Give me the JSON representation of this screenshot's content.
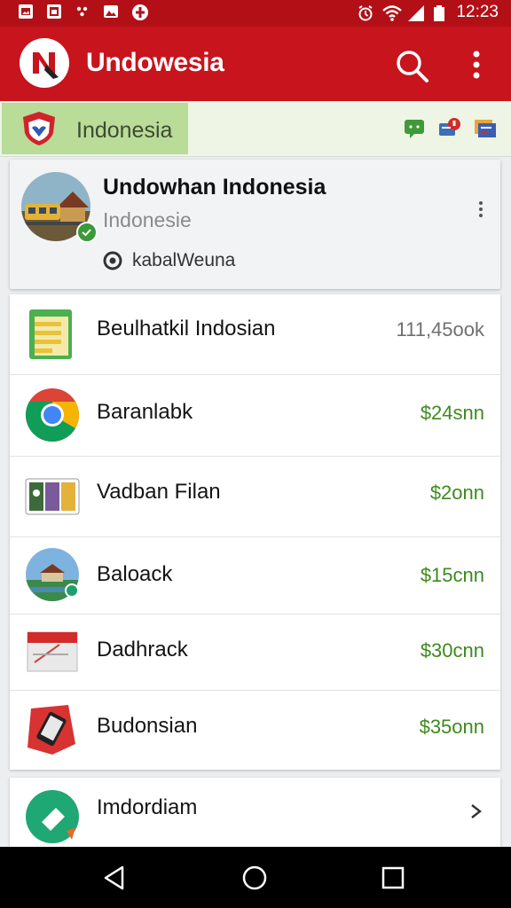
{
  "status_bar": {
    "time": "12:23",
    "left_icons": [
      "image-icon",
      "image-icon",
      "dots-icon",
      "photo-icon",
      "app-icon"
    ],
    "right_icons": [
      "alarm-icon",
      "wifi-icon",
      "signal-icon",
      "battery-icon"
    ]
  },
  "app_bar": {
    "title": "Undowesia",
    "logo_icon": "app-logo-icon",
    "actions": [
      "search-icon",
      "more-vert-icon"
    ],
    "color": "#c8141c"
  },
  "filter_strip": {
    "chip_label": "Indonesia",
    "chip_icon": "shield-flag-icon",
    "right_icons": [
      "message-icon",
      "notification-icon",
      "card-icon"
    ]
  },
  "profile": {
    "name": "Undowhan Indonesia",
    "subtitle": "Indonesie",
    "meta": "kabalWeuna",
    "meta_icon": "clock-icon"
  },
  "list": {
    "items": [
      {
        "title": "Beulhatkil Indosian",
        "value": "111,45ook",
        "icon": "spreadsheet-icon"
      },
      {
        "title": "Baranlabk",
        "value": "$24snn",
        "icon": "chrome-icon"
      },
      {
        "title": "Vadban Filan",
        "value": "$2onn",
        "icon": "gallery-icon"
      },
      {
        "title": "Baloack",
        "value": "$15cnn",
        "icon": "landmark-icon"
      },
      {
        "title": "Dadhrack",
        "value": "$30cnn",
        "icon": "envelope-icon"
      },
      {
        "title": "Budonsian",
        "value": "$35onn",
        "icon": "phone-icon"
      }
    ]
  },
  "bottom_item": {
    "title": "Imdordiam",
    "icon": "tag-icon",
    "chevron": "chevron-right-icon"
  },
  "nav_bar": {
    "buttons": [
      "back-icon",
      "home-icon",
      "recents-icon"
    ]
  },
  "colors": {
    "accent": "#c8141c",
    "value_green": "#3e8a1e",
    "chip_green": "#b9dc98"
  }
}
